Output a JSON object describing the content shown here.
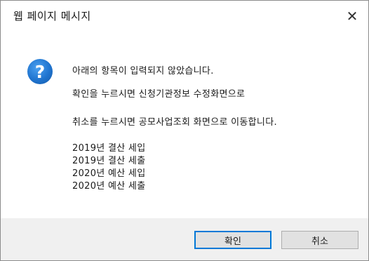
{
  "window": {
    "title": "웹 페이지 메시지",
    "close_glyph": "✕"
  },
  "message": {
    "icon": "question-icon",
    "icon_glyph": "?",
    "line1": "아래의 항목이 입력되지 않았습니다.",
    "line2": "확인을 누르시면 신청기관정보 수정화면으로",
    "line3": "취소를 누르시면 공모사업조회 화면으로 이동합니다.",
    "items": [
      "2019년 결산 세입",
      "2019년 결산 세출",
      "2020년 예산 세입",
      "2020년 예산 세출"
    ]
  },
  "buttons": {
    "ok_label": "확인",
    "cancel_label": "취소"
  },
  "colors": {
    "accent": "#0078d7",
    "icon_blue": "#1f74cf",
    "footer_bg": "#f0f0f0"
  }
}
